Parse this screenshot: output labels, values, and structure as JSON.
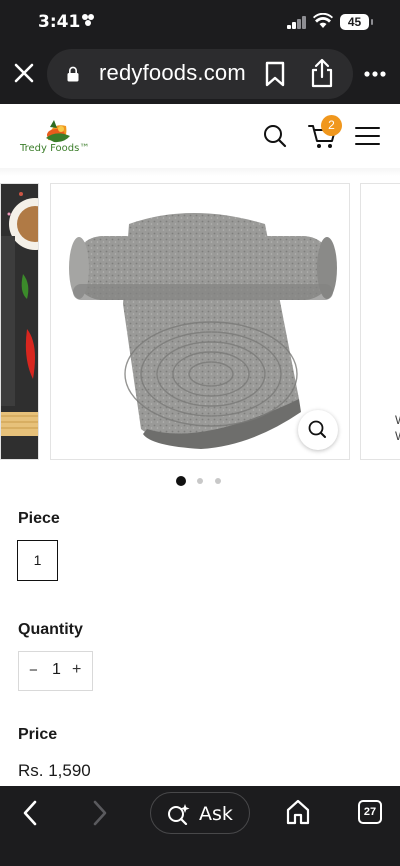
{
  "status_bar": {
    "time": "3:41",
    "battery_level": "45"
  },
  "browser": {
    "url_text": "redyfoods.com"
  },
  "header": {
    "logo_text": "Tredy Foods™",
    "cart_count": "2"
  },
  "gallery": {
    "next_slide_text": "W\nW",
    "dot_count": 3,
    "active_dot": 0
  },
  "product": {
    "piece_label": "Piece",
    "piece_option": "1",
    "quantity_label": "Quantity",
    "quantity_minus": "−",
    "quantity_value": "1",
    "quantity_plus": "+",
    "price_label": "Price",
    "price_value": "Rs. 1,590"
  },
  "toolbar": {
    "ask_label": "Ask",
    "tabs_count": "27"
  },
  "colors": {
    "browser_chrome": "#1c1c1e",
    "cart_badge": "#f0971d",
    "logo_green": "#3b7d2a"
  }
}
